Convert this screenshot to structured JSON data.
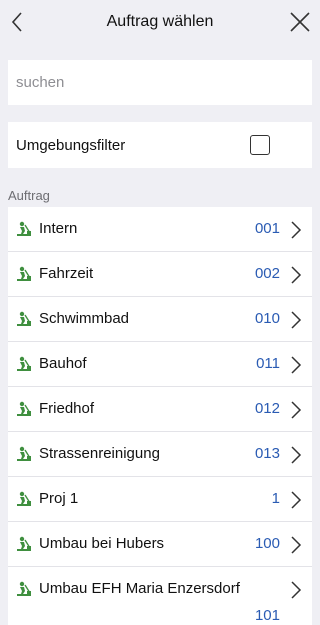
{
  "header": {
    "title": "Auftrag wählen"
  },
  "search": {
    "placeholder": "suchen"
  },
  "filter": {
    "label": "Umgebungsfilter",
    "checked": false
  },
  "section": {
    "label": "Auftrag"
  },
  "jobs": [
    {
      "name": "Intern",
      "code": "001"
    },
    {
      "name": "Fahrzeit",
      "code": "002"
    },
    {
      "name": "Schwimmbad",
      "code": "010"
    },
    {
      "name": "Bauhof",
      "code": "011"
    },
    {
      "name": "Friedhof",
      "code": "012"
    },
    {
      "name": "Strassenreinigung",
      "code": "013"
    },
    {
      "name": "Proj 1",
      "code": "1"
    },
    {
      "name": "Umbau bei Hubers",
      "code": "100"
    },
    {
      "name": "Umbau EFH Maria Enzersdorf",
      "code": "101"
    }
  ],
  "icons": {
    "back": "chevron-left-icon",
    "close": "close-icon",
    "job": "construction-worker-icon",
    "row_arrow": "chevron-right-icon"
  },
  "colors": {
    "background": "#efeff4",
    "code_text": "#2a5bb3",
    "icon_green": "#3f8f3f"
  }
}
